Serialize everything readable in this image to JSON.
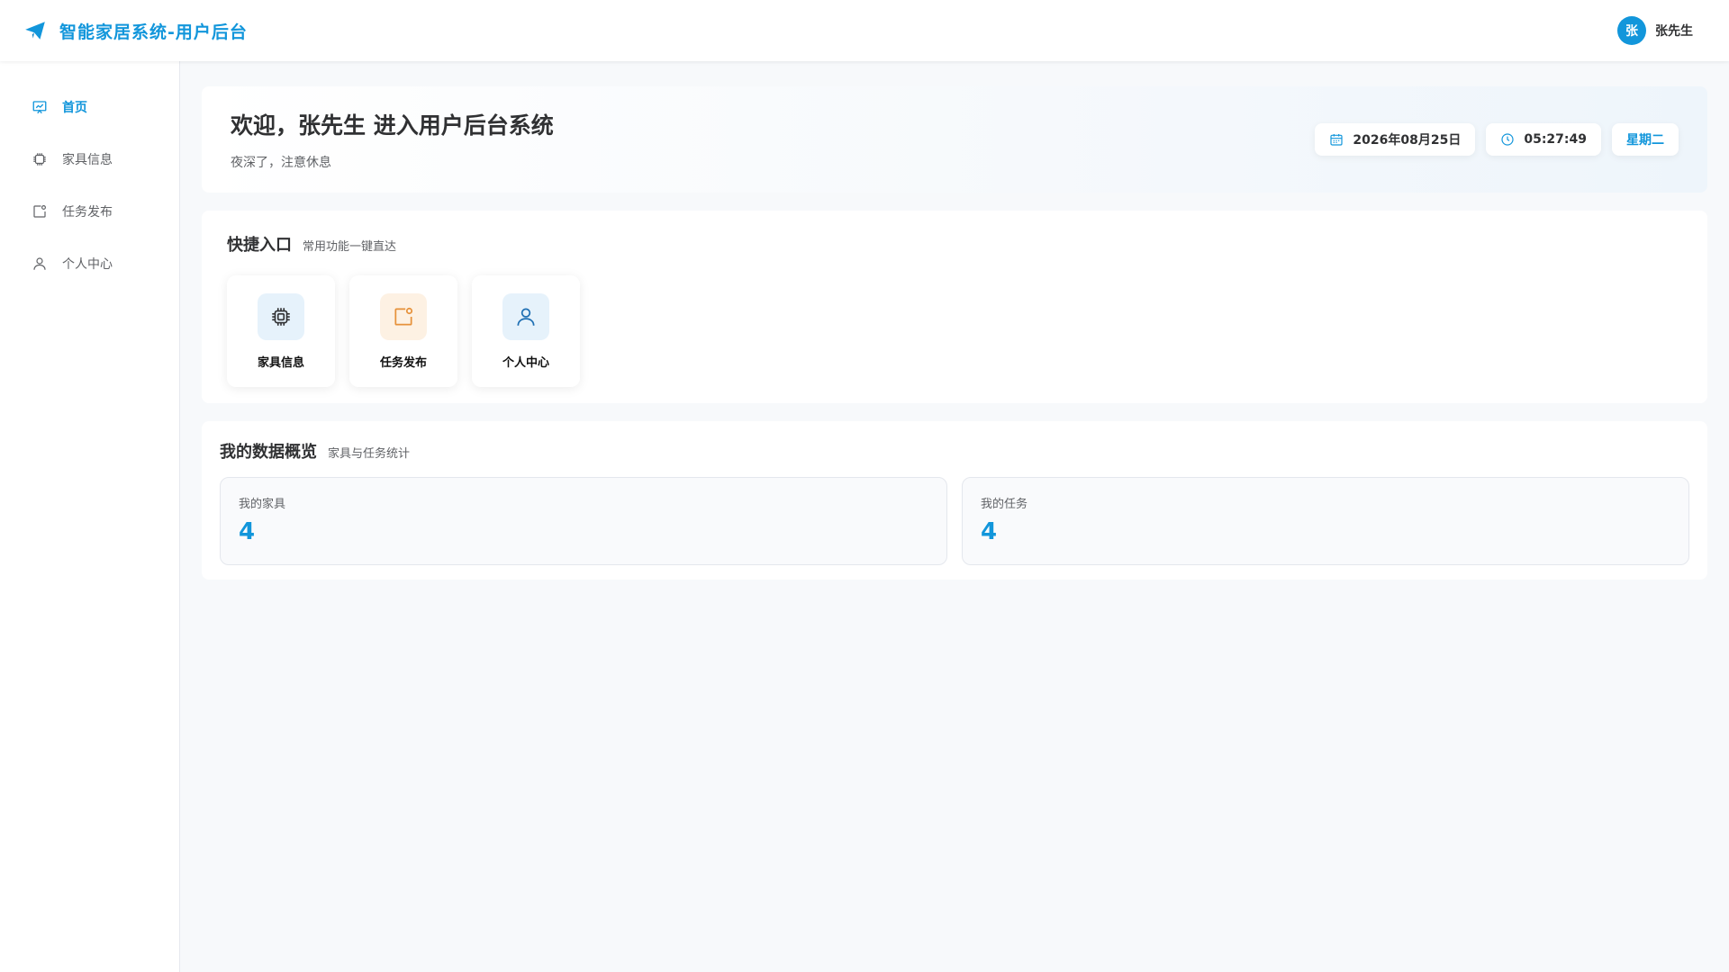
{
  "header": {
    "brand_title": "智能家居系统-用户后台",
    "brand_icon": "paper-plane-icon",
    "user": {
      "avatar_text": "张",
      "name": "张先生"
    }
  },
  "sidebar": {
    "items": [
      {
        "label": "首页",
        "icon": "home-icon",
        "active": true
      },
      {
        "label": "家具信息",
        "icon": "chip-icon",
        "active": false
      },
      {
        "label": "任务发布",
        "icon": "task-icon",
        "active": false
      },
      {
        "label": "个人中心",
        "icon": "user-icon",
        "active": false
      }
    ]
  },
  "welcome": {
    "title": "欢迎，张先生 进入用户后台系统",
    "subtitle": "夜深了，注意休息",
    "date": "2026年08月25日",
    "time": "05:27:49",
    "weekday": "星期二"
  },
  "quick": {
    "title": "快捷入口",
    "subtitle": "常用功能一键直达",
    "items": [
      {
        "label": "家具信息",
        "icon": "chip-icon"
      },
      {
        "label": "任务发布",
        "icon": "task-icon"
      },
      {
        "label": "个人中心",
        "icon": "user-icon"
      }
    ]
  },
  "overview": {
    "title": "我的数据概览",
    "subtitle": "家具与任务统计",
    "stats": [
      {
        "label": "我的家具",
        "value": "4"
      },
      {
        "label": "我的任务",
        "value": "4"
      }
    ]
  },
  "colors": {
    "accent": "#1296db",
    "page_bg": "#f7f9fb",
    "orange_icon": "#e6913a"
  }
}
